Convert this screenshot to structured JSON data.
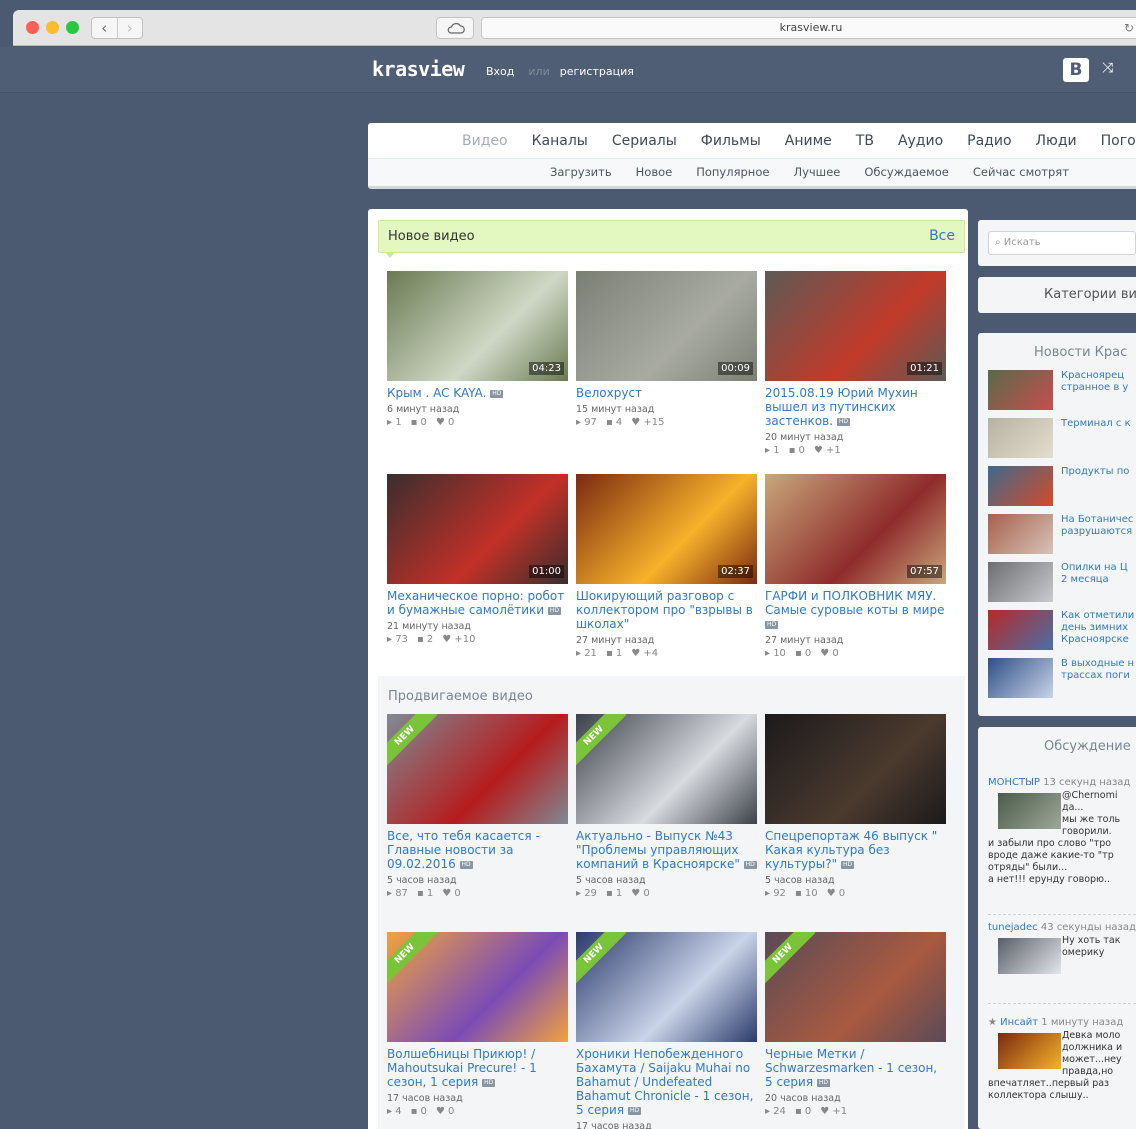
{
  "browser": {
    "url": "krasview.ru",
    "back_icon": "‹",
    "forward_icon": "›"
  },
  "site": {
    "logo": "krasview",
    "login": "Вход",
    "or": "или",
    "register": "регистрация",
    "vk_label": "B"
  },
  "nav": {
    "main": [
      "Видео",
      "Каналы",
      "Сериалы",
      "Фильмы",
      "Аниме",
      "ТВ",
      "Аудио",
      "Радио",
      "Люди",
      "Погода"
    ],
    "active": "Видео",
    "sub": [
      "Загрузить",
      "Новое",
      "Популярное",
      "Лучшее",
      "Обсуждаемое",
      "Сейчас смотрят"
    ]
  },
  "new_videos": {
    "title": "Новое видео",
    "all_link": "Все",
    "items": [
      {
        "title": "Крым . AC KAYA.",
        "hd": true,
        "duration": "04:23",
        "time": "6 минут назад",
        "views": "1",
        "comments": "0",
        "likes": "0",
        "color1": "#6b7a52",
        "color2": "#cfd8c6"
      },
      {
        "title": "Велохруст",
        "hd": false,
        "duration": "00:09",
        "time": "15 минут назад",
        "views": "97",
        "comments": "4",
        "likes": "+15",
        "color1": "#7a7f74",
        "color2": "#a9aba2"
      },
      {
        "title": "2015.08.19 Юрий Мухин вышел из путинских застенков.",
        "hd": true,
        "duration": "01:21",
        "time": "20 минут назад",
        "views": "1",
        "comments": "0",
        "likes": "+1",
        "color1": "#5d5a55",
        "color2": "#c23a2a"
      },
      {
        "title": "Механическое порно: робот и бумажные самолётики",
        "hd": true,
        "duration": "01:00",
        "time": "21 минуту назад",
        "views": "73",
        "comments": "2",
        "likes": "+10",
        "color1": "#3a2e2e",
        "color2": "#c23027"
      },
      {
        "title": "Шокирующий разговор с коллектором про \"взрывы в школах\"",
        "hd": false,
        "duration": "02:37",
        "time": "27 минут назад",
        "views": "21",
        "comments": "1",
        "likes": "+4",
        "color1": "#7a2a10",
        "color2": "#f7b22a"
      },
      {
        "title": "ГАРФИ и ПОЛКОВНИК МЯУ. Самые суровые коты в мире",
        "hd": true,
        "duration": "07:57",
        "time": "27 минут назад",
        "views": "10",
        "comments": "0",
        "likes": "0",
        "color1": "#c8a77b",
        "color2": "#8f2b2b"
      }
    ]
  },
  "promo": {
    "title": "Продвигаемое видео",
    "badge": "NEW",
    "items": [
      {
        "title": "Все, что тебя касается - Главные новости за 09.02.2016",
        "hd": true,
        "new": true,
        "time": "5 часов назад",
        "views": "87",
        "comments": "1",
        "likes": "0",
        "color1": "#7f8a95",
        "color2": "#b51c1c"
      },
      {
        "title": "Актуально - Выпуск №43 \"Проблемы управляющих компаний в Красноярске\"",
        "hd": true,
        "new": true,
        "time": "5 часов назад",
        "views": "29",
        "comments": "1",
        "likes": "0",
        "color1": "#3c4048",
        "color2": "#d7dbe0"
      },
      {
        "title": "Спецрепортаж 46 выпуск \" Какая культура без культуры?\"",
        "hd": true,
        "new": false,
        "time": "5 часов назад",
        "views": "92",
        "comments": "10",
        "likes": "0",
        "color1": "#1b1a1c",
        "color2": "#4b3a2e"
      },
      {
        "title": "Волшебницы Прикюр! / Mahoutsukai Precure! - 1 сезон, 1 серия",
        "hd": true,
        "new": true,
        "time": "17 часов назад",
        "views": "4",
        "comments": "0",
        "likes": "0",
        "color1": "#f1a23c",
        "color2": "#7b4cb6"
      },
      {
        "title": "Хроники Непобежденного Бахамута / Saijaku Muhai no Bahamut / Undefeated Bahamut Chronicle - 1 сезон, 5 серия",
        "hd": true,
        "new": true,
        "time": "17 часов назад",
        "views": "",
        "comments": "",
        "likes": "",
        "color1": "#2b3a6c",
        "color2": "#c9d4e8"
      },
      {
        "title": "Черные Метки / Schwarzesmarken - 1 сезон, 5 серия",
        "hd": true,
        "new": true,
        "time": "20 часов назад",
        "views": "24",
        "comments": "0",
        "likes": "+1",
        "color1": "#5a4a58",
        "color2": "#a95a3f"
      }
    ]
  },
  "sidebar": {
    "search_placeholder": "Искать",
    "categories": "Категории ви",
    "news_title": "Новости Крас",
    "news": [
      {
        "text": "Красноярец\nстранное в у",
        "color1": "#586b4a",
        "color2": "#c74e4e"
      },
      {
        "text": "Терминал с к",
        "color1": "#b8b2a2",
        "color2": "#e3ddcf"
      },
      {
        "text": "Продукты по",
        "color1": "#3d6a8c",
        "color2": "#d44b2a"
      },
      {
        "text": "На Ботаничес\nразрушаются",
        "color1": "#a85f4b",
        "color2": "#d6c3b9"
      },
      {
        "text": "Опилки на Ц\n2 месяца",
        "color1": "#6b6d70",
        "color2": "#c9cbce"
      },
      {
        "text": "Как отметили\nдень зимних\nКрасноярске",
        "color1": "#b52a27",
        "color2": "#4b6ea8"
      },
      {
        "text": "В выходные н\nтрассах поги",
        "color1": "#2f4f88",
        "color2": "#c8d3e6"
      }
    ],
    "discussion_title": "Обсуждение",
    "discussions": [
      {
        "user": "МОНСТЫР",
        "time": "13 секунд назад",
        "star": "",
        "text": [
          "@Chernomi",
          "да...",
          "мы же толь",
          "говорили.",
          "и забыли про слово \"тро",
          "вроде даже какие-то \"тр",
          "отряды\" были...",
          "а нет!!! ерунду говорю.."
        ],
        "color1": "#4b5b4a",
        "color2": "#9fa89a"
      },
      {
        "user": "tunejadec",
        "time": "43 секунды назад",
        "star": "",
        "text": [
          "Ну хоть так",
          "омерику"
        ],
        "color1": "#5a5f66",
        "color2": "#e3e7ec"
      },
      {
        "user": "Инсайт",
        "time": "1 минуту назад",
        "star": "★",
        "text": [
          "Девка моло",
          "должника и",
          "может...неу",
          "правда,но",
          "впечатляет..первый раз",
          "коллектора слышу.."
        ],
        "color1": "#7a2a10",
        "color2": "#f7b22a"
      }
    ]
  }
}
